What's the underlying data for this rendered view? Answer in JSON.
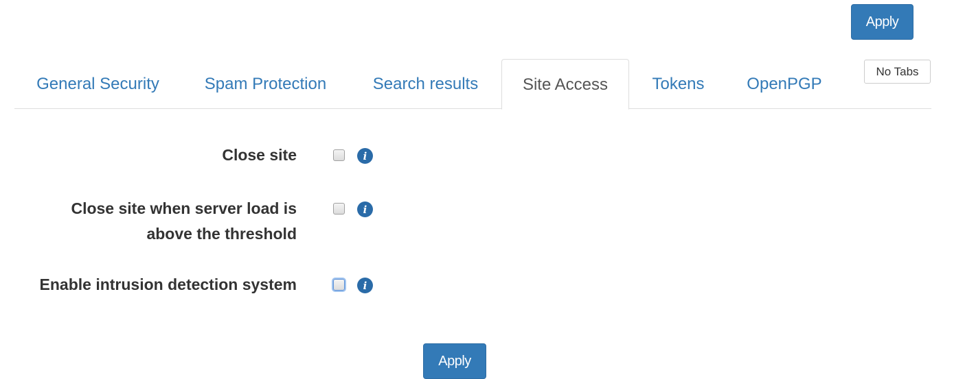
{
  "toolbar": {
    "apply_top_label": "Apply",
    "no_tabs_label": "No Tabs"
  },
  "tabs": [
    {
      "label": "General Security",
      "active": false
    },
    {
      "label": "Spam Protection",
      "active": false
    },
    {
      "label": "Search results",
      "active": false
    },
    {
      "label": "Site Access",
      "active": true
    },
    {
      "label": "Tokens",
      "active": false
    },
    {
      "label": "OpenPGP",
      "active": false
    }
  ],
  "form": {
    "fields": [
      {
        "label": "Close site",
        "checked": false,
        "info_icon": "info-icon"
      },
      {
        "label": "Close site when server load is above the threshold",
        "checked": false,
        "info_icon": "info-icon"
      },
      {
        "label": "Enable intrusion detection system",
        "checked": false,
        "focused": true,
        "info_icon": "info-icon"
      }
    ],
    "apply_bottom_label": "Apply"
  },
  "colors": {
    "primary": "#337ab7",
    "link": "#337ab7",
    "active_tab_text": "#555555",
    "border": "#dddddd"
  }
}
